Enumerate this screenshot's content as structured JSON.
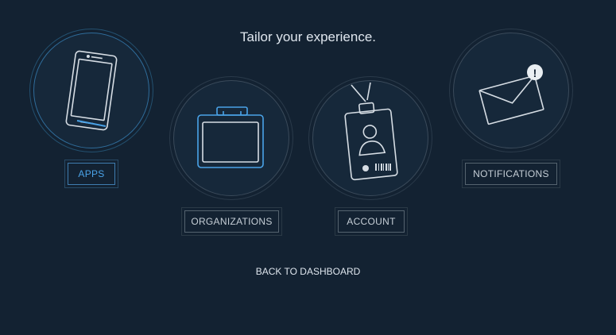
{
  "title": "Tailor your experience.",
  "options": [
    {
      "label": "APPS",
      "icon": "phone-icon",
      "active": true
    },
    {
      "label": "ORGANIZATIONS",
      "icon": "briefcase-icon",
      "active": false
    },
    {
      "label": "ACCOUNT",
      "icon": "id-badge-icon",
      "active": false
    },
    {
      "label": "NOTIFICATIONS",
      "icon": "envelope-alert-icon",
      "active": false
    }
  ],
  "back_label": "BACK TO DASHBOARD",
  "colors": {
    "background": "#132232",
    "accent": "#4aa3e8",
    "text": "#dfe6ee"
  }
}
